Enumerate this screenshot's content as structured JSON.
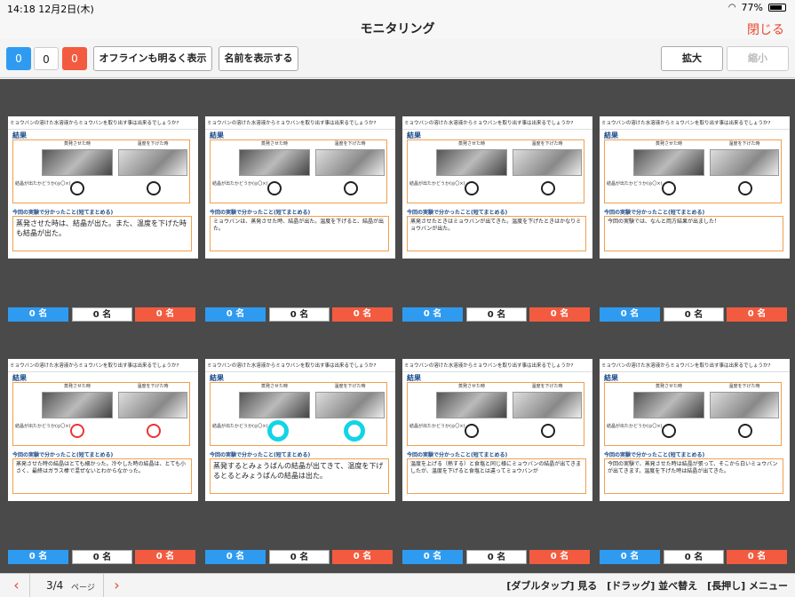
{
  "status": {
    "time": "14:18",
    "date": "12月2日(木)",
    "battery": "77%"
  },
  "nav": {
    "title": "モニタリング",
    "close": "閉じる"
  },
  "toolbar": {
    "count_blue": "0",
    "count_white": "0",
    "count_red": "0",
    "offline_btn": "オフラインも明るく表示",
    "names_btn": "名前を表示する",
    "zoom_in": "拡大",
    "zoom_out": "縮小"
  },
  "sheet_common": {
    "question": "ミョウバンの溶けた水溶液からミョウバンを取り出す事は出来るでしょうか?",
    "result": "結果",
    "col_a": "蒸発させた時",
    "col_b": "温度を下げた時",
    "side": "結晶が出たかどうか(◎〇×)",
    "summary": "今回の実験で分かったこと(短てまとめる)"
  },
  "cells": [
    {
      "text": "蒸発させた時は、結晶が出た。また、温度を下げた時も結晶が出た。",
      "big": true,
      "blue": "0 名",
      "white": "0 名",
      "red": "0 名"
    },
    {
      "text": "ミョウバンは、蒸発させた時、結晶が出た。温度を下げると、結晶が出た。",
      "big": false,
      "blue": "0 名",
      "white": "0 名",
      "red": "0 名"
    },
    {
      "text": "蒸発させたときはミョウバンが出てきた。温度を下げたときはかなりミョウバンが出た。",
      "big": false,
      "blue": "0 名",
      "white": "0 名",
      "red": "0 名"
    },
    {
      "text": "今回の実験では、なんと両方結果が出ました！",
      "big": false,
      "blue": "0 名",
      "white": "0 名",
      "red": "0 名"
    },
    {
      "text": "蒸発させた時の結晶はとても細かった。冷やした時の結晶は、とても小さく、最終はガラス棒で混ぜないとわからなかった。",
      "big": false,
      "blue": "0 名",
      "white": "0 名",
      "red": "0 名"
    },
    {
      "text": "蒸発するとみょうばんの結晶が出てきて、温度を下げるとるとみょうばんの結晶は出た。",
      "big": true,
      "blue": "0 名",
      "white": "0 名",
      "red": "0 名"
    },
    {
      "text": "温度を上げる（熱する）と食塩と同じ様にミョウバンの結晶が出てきましたが、温度を下げると食塩とは違ってミョウバンが",
      "big": false,
      "blue": "0 名",
      "white": "0 名",
      "red": "0 名"
    },
    {
      "text": "今回の実験で、蒸発させた時は結晶が張って、そこから白いミョウバンが出てきます。温度を下げた時は結晶が出てきた。",
      "big": false,
      "blue": "0 名",
      "white": "0 名",
      "red": "0 名"
    }
  ],
  "footer": {
    "page": "3/4",
    "page_unit": "ページ",
    "hint": "[ダブルタップ] 見る　[ドラッグ] 並べ替え　[長押し] メニュー"
  }
}
